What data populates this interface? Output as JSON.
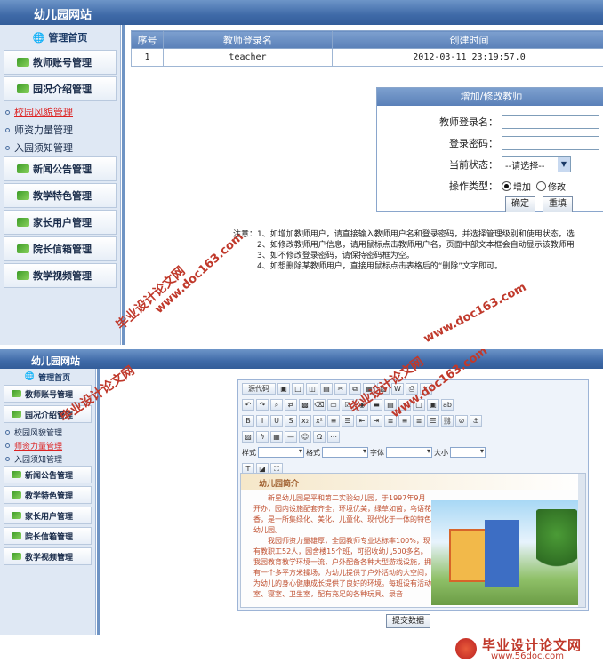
{
  "top": {
    "site_title": "幼儿园网站",
    "sidebar": {
      "home": "管理首页",
      "buttons_before": [
        "教师账号管理",
        "园况介绍管理"
      ],
      "links": [
        {
          "label": "校园风貌管理",
          "active": true
        },
        {
          "label": "师资力量管理",
          "active": false
        },
        {
          "label": "入园须知管理",
          "active": false
        }
      ],
      "buttons_after": [
        "新闻公告管理",
        "教学特色管理",
        "家长用户管理",
        "院长信箱管理",
        "教学视频管理"
      ]
    },
    "table": {
      "headers": [
        "序号",
        "教师登录名",
        "创建时间"
      ],
      "rows": [
        [
          "1",
          "teacher",
          "2012-03-11 23:19:57.0"
        ]
      ]
    },
    "form": {
      "title": "增加/修改教师",
      "login_label": "教师登录名：",
      "password_label": "登录密码：",
      "status_label": "当前状态：",
      "status_value": "--请选择--",
      "op_label": "操作类型：",
      "op_add": "增加",
      "op_edit": "修改",
      "op_selected": "add",
      "confirm": "确定",
      "reset": "重填"
    },
    "notes": {
      "label": "注意：",
      "lines": [
        "1、如增加教师用户，请直接输入教师用户名和登录密码，并选择管理级别和使用状态，选",
        "2、如修改教师用户信息，请用鼠标点击教师用户名，页面中部文本框会自动显示该教师用",
        "3、如不修改登录密码，请保持密码框为空。",
        "4、如想删除某教师用户，直接用鼠标点击表格后的“删除”文字即可。"
      ]
    }
  },
  "bottom": {
    "site_title": "幼儿园网站",
    "sidebar": {
      "home": "管理首页",
      "buttons_before": [
        "教师账号管理",
        "园况介绍管理"
      ],
      "links": [
        {
          "label": "校园风貌管理",
          "active": false
        },
        {
          "label": "师资力量管理",
          "active": true
        },
        {
          "label": "入园须知管理",
          "active": false
        }
      ],
      "buttons_after": [
        "新闻公告管理",
        "教学特色管理",
        "家长用户管理",
        "院长信箱管理",
        "教学视频管理"
      ]
    },
    "editor": {
      "source_btn": "源代码",
      "style_label": "样式",
      "format_label": "格式",
      "font_label": "字体",
      "size_label": "大小",
      "doc_heading": "幼儿园简介",
      "doc_paragraphs": [
        "新星幼儿园是平和第二实验幼儿园，于1997年9月开办，园内设施配套齐全，环境优美，绿草如茵，鸟语花香，是一所集绿化、美化、儿童化、现代化于一体的特色幼儿园。",
        "我园师资力量雄厚，全园教师专业达标率100%，现有教职工52人，园舍楼15个班，可招收幼儿500多名。我园教育教学环境一流，户外配备各种大型游戏设施，拥有一个多平方米操场，为幼儿提供了户外活动的大空间，为幼儿的身心健康成长提供了良好的环境。每班设有活动室、寝室、卫生室，配有充足的各种玩具、录音"
      ]
    },
    "submit": "提交数据"
  },
  "watermarks": {
    "site1": "www.doc163.com",
    "brand": "毕业设计论文网",
    "site2": "www.56doc.com"
  },
  "colors": {
    "accent": "#3f6aa8",
    "watermark": "#c0392b",
    "active_link": "#d22222"
  }
}
